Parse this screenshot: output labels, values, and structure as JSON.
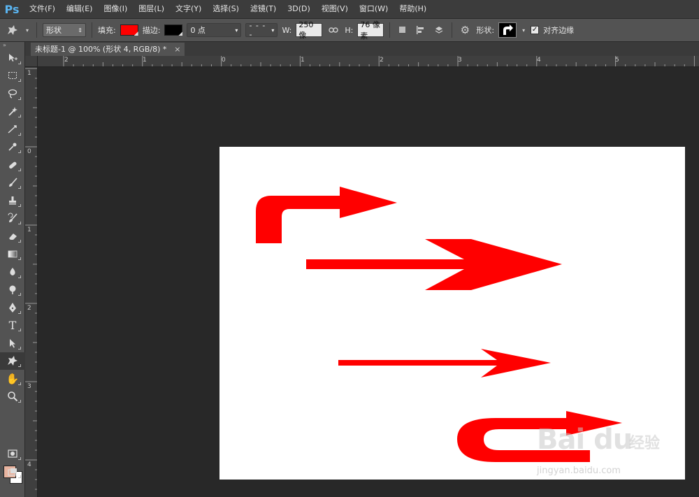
{
  "app": {
    "logo": "Ps"
  },
  "menu": [
    "文件(F)",
    "编辑(E)",
    "图像(I)",
    "图层(L)",
    "文字(Y)",
    "选择(S)",
    "滤镜(T)",
    "3D(D)",
    "视图(V)",
    "窗口(W)",
    "帮助(H)"
  ],
  "options": {
    "mode_select": "形状",
    "fill_label": "填充:",
    "fill_color": "#ff0000",
    "stroke_label": "描边:",
    "stroke_color": "#000000",
    "stroke_width": "0 点",
    "w_label": "W:",
    "w_value": "250 像",
    "h_label": "H:",
    "h_value": "76 像素",
    "shape_label": "形状:",
    "align_edges_label": "对齐边缘",
    "align_edges_checked": "✓"
  },
  "document": {
    "tab_title": "未标题-1 @ 100% (形状 4, RGB/8) *",
    "tab_close": "×"
  },
  "rulers": {
    "h_labels": [
      "2",
      "1",
      "0",
      "1",
      "2",
      "3",
      "4",
      "5"
    ],
    "v_labels": [
      "1",
      "0",
      "1",
      "2",
      "3",
      "4"
    ]
  },
  "canvas": {
    "background": "#ffffff",
    "arrow_color": "#ff0000"
  },
  "watermark": {
    "brand": "Bai du",
    "cn": "经验",
    "url": "jingyan.baidu.com"
  },
  "colors": {
    "foreground": "#e8b4a0",
    "background": "#ffffff"
  }
}
